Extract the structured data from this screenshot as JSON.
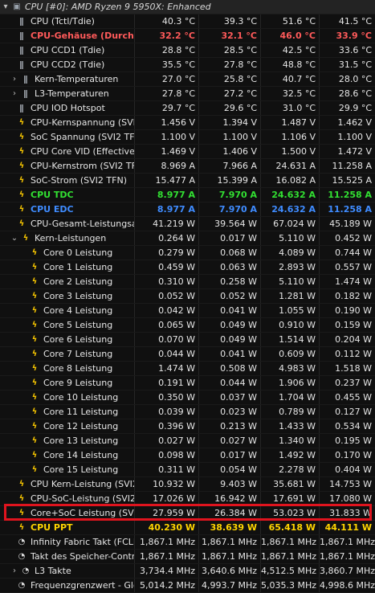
{
  "section_title": "CPU [#0]: AMD Ryzen 9 5950X: Enhanced",
  "rows": [
    {
      "label": "CPU (Tctl/Tdie)",
      "v": [
        "40.3 °C",
        "39.3 °C",
        "51.6 °C",
        "41.5 °C"
      ],
      "icon": "thermometer-icon",
      "indent": 1,
      "style": ""
    },
    {
      "label": "CPU-Gehäuse (Durchschnitt)",
      "v": [
        "32.2 °C",
        "32.1 °C",
        "46.0 °C",
        "33.9 °C"
      ],
      "icon": "thermometer-icon",
      "indent": 1,
      "style": "red"
    },
    {
      "label": "CPU CCD1 (Tdie)",
      "v": [
        "28.8 °C",
        "28.5 °C",
        "42.5 °C",
        "33.6 °C"
      ],
      "icon": "thermometer-icon",
      "indent": 1,
      "style": ""
    },
    {
      "label": "CPU CCD2 (Tdie)",
      "v": [
        "35.5 °C",
        "27.8 °C",
        "48.8 °C",
        "31.5 °C"
      ],
      "icon": "thermometer-icon",
      "indent": 1,
      "style": ""
    },
    {
      "label": "Kern-Temperaturen",
      "v": [
        "27.0 °C",
        "25.8 °C",
        "40.7 °C",
        "28.0 °C"
      ],
      "icon": "thermometer-icon",
      "indent": 2,
      "expander": "collapsed",
      "style": ""
    },
    {
      "label": "L3-Temperaturen",
      "v": [
        "27.8 °C",
        "27.2 °C",
        "32.5 °C",
        "28.6 °C"
      ],
      "icon": "thermometer-icon",
      "indent": 2,
      "expander": "collapsed",
      "style": ""
    },
    {
      "label": "CPU IOD Hotspot",
      "v": [
        "29.7 °C",
        "29.6 °C",
        "31.0 °C",
        "29.9 °C"
      ],
      "icon": "thermometer-icon",
      "indent": 1,
      "style": ""
    },
    {
      "label": "CPU-Kernspannung (SVI2 TFN)",
      "v": [
        "1.456 V",
        "1.394 V",
        "1.487 V",
        "1.462 V"
      ],
      "icon": "bolt-icon",
      "indent": 1,
      "style": ""
    },
    {
      "label": "SoC Spannung (SVI2 TFN)",
      "v": [
        "1.100 V",
        "1.100 V",
        "1.106 V",
        "1.100 V"
      ],
      "icon": "bolt-icon",
      "indent": 1,
      "style": ""
    },
    {
      "label": "CPU Core VID (Effective)",
      "v": [
        "1.469 V",
        "1.406 V",
        "1.500 V",
        "1.472 V"
      ],
      "icon": "bolt-icon",
      "indent": 1,
      "style": ""
    },
    {
      "label": "CPU-Kernstrom (SVI2 TFN)",
      "v": [
        "8.969 A",
        "7.966 A",
        "24.631 A",
        "11.258 A"
      ],
      "icon": "bolt-icon",
      "indent": 1,
      "style": ""
    },
    {
      "label": "SoC-Strom (SVI2 TFN)",
      "v": [
        "15.477 A",
        "15.399 A",
        "16.082 A",
        "15.525 A"
      ],
      "icon": "bolt-icon",
      "indent": 1,
      "style": ""
    },
    {
      "label": "CPU TDC",
      "v": [
        "8.977 A",
        "7.970 A",
        "24.632 A",
        "11.258 A"
      ],
      "icon": "bolt-icon",
      "indent": 1,
      "style": "green"
    },
    {
      "label": "CPU EDC",
      "v": [
        "8.977 A",
        "7.970 A",
        "24.632 A",
        "11.258 A"
      ],
      "icon": "bolt-icon",
      "indent": 1,
      "style": "blue"
    },
    {
      "label": "CPU-Gesamt-Leistungsaufnahme",
      "v": [
        "41.219 W",
        "39.564 W",
        "67.024 W",
        "45.189 W"
      ],
      "icon": "bolt-icon",
      "indent": 1,
      "style": ""
    },
    {
      "label": "Kern-Leistungen",
      "v": [
        "0.264 W",
        "0.017 W",
        "5.110 W",
        "0.452 W"
      ],
      "icon": "bolt-icon",
      "indent": 2,
      "expander": "expanded",
      "style": ""
    },
    {
      "label": "Core 0 Leistung",
      "v": [
        "0.279 W",
        "0.068 W",
        "4.089 W",
        "0.744 W"
      ],
      "icon": "bolt-icon",
      "indent": 3,
      "style": ""
    },
    {
      "label": "Core 1 Leistung",
      "v": [
        "0.459 W",
        "0.063 W",
        "2.893 W",
        "0.557 W"
      ],
      "icon": "bolt-icon",
      "indent": 3,
      "style": ""
    },
    {
      "label": "Core 2 Leistung",
      "v": [
        "0.310 W",
        "0.258 W",
        "5.110 W",
        "1.474 W"
      ],
      "icon": "bolt-icon",
      "indent": 3,
      "style": ""
    },
    {
      "label": "Core 3 Leistung",
      "v": [
        "0.052 W",
        "0.052 W",
        "1.281 W",
        "0.182 W"
      ],
      "icon": "bolt-icon",
      "indent": 3,
      "style": ""
    },
    {
      "label": "Core 4 Leistung",
      "v": [
        "0.042 W",
        "0.041 W",
        "1.055 W",
        "0.190 W"
      ],
      "icon": "bolt-icon",
      "indent": 3,
      "style": ""
    },
    {
      "label": "Core 5 Leistung",
      "v": [
        "0.065 W",
        "0.049 W",
        "0.910 W",
        "0.159 W"
      ],
      "icon": "bolt-icon",
      "indent": 3,
      "style": ""
    },
    {
      "label": "Core 6 Leistung",
      "v": [
        "0.070 W",
        "0.049 W",
        "1.514 W",
        "0.204 W"
      ],
      "icon": "bolt-icon",
      "indent": 3,
      "style": ""
    },
    {
      "label": "Core 7 Leistung",
      "v": [
        "0.044 W",
        "0.041 W",
        "0.609 W",
        "0.112 W"
      ],
      "icon": "bolt-icon",
      "indent": 3,
      "style": ""
    },
    {
      "label": "Core 8 Leistung",
      "v": [
        "1.474 W",
        "0.508 W",
        "4.983 W",
        "1.518 W"
      ],
      "icon": "bolt-icon",
      "indent": 3,
      "style": ""
    },
    {
      "label": "Core 9 Leistung",
      "v": [
        "0.191 W",
        "0.044 W",
        "1.906 W",
        "0.237 W"
      ],
      "icon": "bolt-icon",
      "indent": 3,
      "style": ""
    },
    {
      "label": "Core 10 Leistung",
      "v": [
        "0.350 W",
        "0.037 W",
        "1.704 W",
        "0.455 W"
      ],
      "icon": "bolt-icon",
      "indent": 3,
      "style": ""
    },
    {
      "label": "Core 11 Leistung",
      "v": [
        "0.039 W",
        "0.023 W",
        "0.789 W",
        "0.127 W"
      ],
      "icon": "bolt-icon",
      "indent": 3,
      "style": ""
    },
    {
      "label": "Core 12 Leistung",
      "v": [
        "0.396 W",
        "0.213 W",
        "1.433 W",
        "0.534 W"
      ],
      "icon": "bolt-icon",
      "indent": 3,
      "style": ""
    },
    {
      "label": "Core 13 Leistung",
      "v": [
        "0.027 W",
        "0.027 W",
        "1.340 W",
        "0.195 W"
      ],
      "icon": "bolt-icon",
      "indent": 3,
      "style": ""
    },
    {
      "label": "Core 14 Leistung",
      "v": [
        "0.098 W",
        "0.017 W",
        "1.492 W",
        "0.170 W"
      ],
      "icon": "bolt-icon",
      "indent": 3,
      "style": ""
    },
    {
      "label": "Core 15 Leistung",
      "v": [
        "0.311 W",
        "0.054 W",
        "2.278 W",
        "0.404 W"
      ],
      "icon": "bolt-icon",
      "indent": 3,
      "style": ""
    },
    {
      "label": "CPU Kern-Leistung (SVI2 TFN)",
      "v": [
        "10.932 W",
        "9.403 W",
        "35.681 W",
        "14.753 W"
      ],
      "icon": "bolt-icon",
      "indent": 1,
      "style": ""
    },
    {
      "label": "CPU-SoC-Leistung (SVI2 TFN)",
      "v": [
        "17.026 W",
        "16.942 W",
        "17.691 W",
        "17.080 W"
      ],
      "icon": "bolt-icon",
      "indent": 1,
      "style": ""
    },
    {
      "label": "Core+SoC Leistung (SVI2 TFN)",
      "v": [
        "27.959 W",
        "26.384 W",
        "53.023 W",
        "31.833 W"
      ],
      "icon": "bolt-icon",
      "indent": 1,
      "style": ""
    },
    {
      "label": "CPU PPT",
      "v": [
        "40.230 W",
        "38.639 W",
        "65.418 W",
        "44.111 W"
      ],
      "icon": "bolt-icon",
      "indent": 1,
      "style": "yellow"
    },
    {
      "label": "Infinity Fabric Takt (FCLK)",
      "v": [
        "1,867.1 MHz",
        "1,867.1 MHz",
        "1,867.1 MHz",
        "1,867.1 MHz"
      ],
      "icon": "clock-icon",
      "indent": 1,
      "style": ""
    },
    {
      "label": "Takt des Speicher-Controllers (UCLK)",
      "v": [
        "1,867.1 MHz",
        "1,867.1 MHz",
        "1,867.1 MHz",
        "1,867.1 MHz"
      ],
      "icon": "clock-icon",
      "indent": 1,
      "style": ""
    },
    {
      "label": "L3 Takte",
      "v": [
        "3,734.4 MHz",
        "3,640.6 MHz",
        "4,512.5 MHz",
        "3,860.7 MHz"
      ],
      "icon": "clock-icon",
      "indent": 2,
      "expander": "collapsed",
      "style": ""
    },
    {
      "label": "Frequenzgrenzwert - Global",
      "v": [
        "5,014.2 MHz",
        "4,993.7 MHz",
        "5,035.3 MHz",
        "4,998.6 MHz"
      ],
      "icon": "clock-icon",
      "indent": 1,
      "style": ""
    }
  ],
  "highlight_color": "#e0141e"
}
